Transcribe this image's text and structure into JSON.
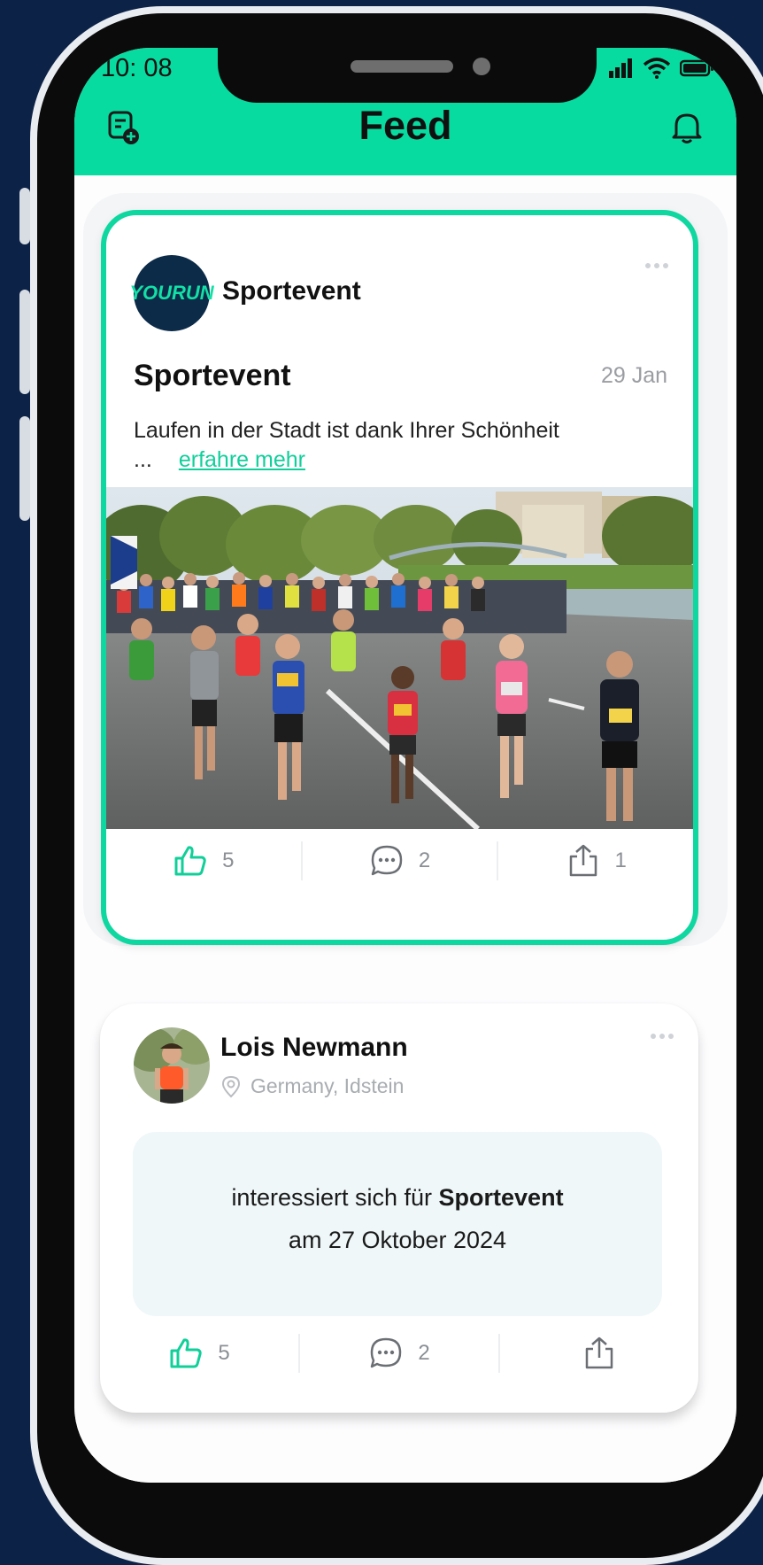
{
  "status_bar": {
    "time": "10: 08"
  },
  "header": {
    "title": "Feed"
  },
  "colors": {
    "accent": "#08db9f",
    "link": "#11cf9b",
    "background": "#0c2247"
  },
  "icons": {
    "left": "new-post-icon",
    "right": "bell-icon"
  },
  "post1": {
    "author_logo_text": "YOURUN",
    "author": "Sportevent",
    "title": "Sportevent",
    "date": "29 Jan",
    "text": "Laufen in der Stadt ist dank Ihrer Schönheit ...",
    "more_label": "erfahre mehr",
    "likes": "5",
    "comments": "2",
    "shares": "1"
  },
  "post2": {
    "author": "Lois Newmann",
    "location": "Germany, Idstein",
    "interest_prefix": "interessiert sich für",
    "interest_event": "Sportevent",
    "interest_date": "am 27 Oktober 2024",
    "likes": "5",
    "comments": "2"
  }
}
